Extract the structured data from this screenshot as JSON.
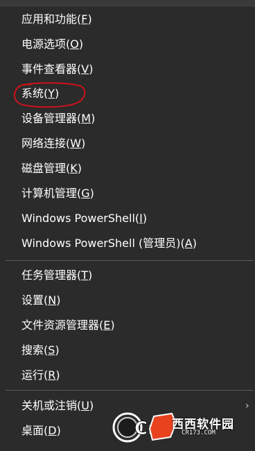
{
  "menu": {
    "items": [
      {
        "label": "应用和功能",
        "key": "F"
      },
      {
        "label": "电源选项",
        "key": "O"
      },
      {
        "label": "事件查看器",
        "key": "V"
      },
      {
        "label": "系统",
        "key": "Y"
      },
      {
        "label": "设备管理器",
        "key": "M"
      },
      {
        "label": "网络连接",
        "key": "W"
      },
      {
        "label": "磁盘管理",
        "key": "K"
      },
      {
        "label": "计算机管理",
        "key": "G"
      },
      {
        "label": "Windows PowerShell",
        "key": "I"
      },
      {
        "label": "Windows PowerShell (管理员)",
        "key": "A"
      },
      {
        "label": "任务管理器",
        "key": "T"
      },
      {
        "label": "设置",
        "key": "N"
      },
      {
        "label": "文件资源管理器",
        "key": "E"
      },
      {
        "label": "搜索",
        "key": "S"
      },
      {
        "label": "运行",
        "key": "R"
      },
      {
        "label": "关机或注销",
        "key": "U"
      },
      {
        "label": "桌面",
        "key": "D"
      }
    ],
    "submenu_indicator": "›"
  },
  "watermark": {
    "brand": "西西软件园",
    "logo_text": "Cr",
    "url": "CR173.COM"
  },
  "colors": {
    "background": "#2b2b2b",
    "text": "#ffffff",
    "divider": "#5a5a5a",
    "annotation": "#d0121b"
  },
  "icons": [
    "chevron-right-icon",
    "red-circle-annotation"
  ]
}
